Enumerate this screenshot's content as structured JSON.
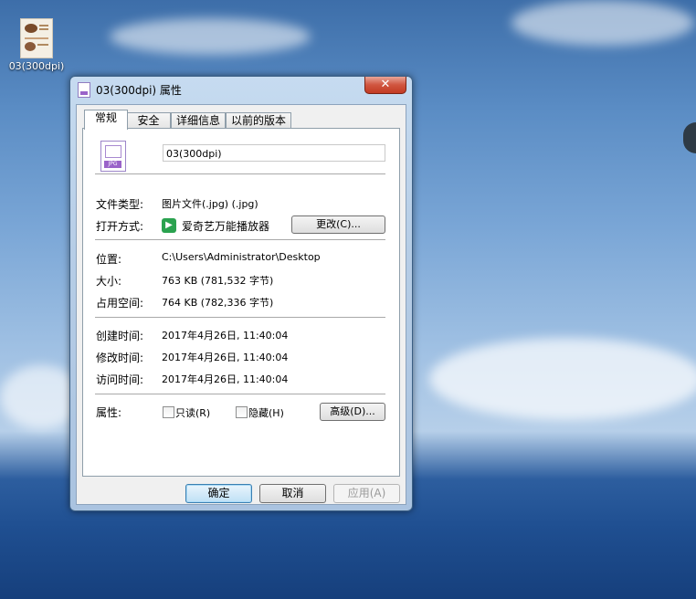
{
  "desktop": {
    "icon_label": "03(300dpi)"
  },
  "window": {
    "title": "03(300dpi) 属性",
    "close_glyph": "✕",
    "tabs": [
      {
        "label": "常规",
        "active": true
      },
      {
        "label": "安全",
        "active": false
      },
      {
        "label": "详细信息",
        "active": false
      },
      {
        "label": "以前的版本",
        "active": false
      }
    ],
    "file_icon_text": "JPG",
    "file_name": "03(300dpi)",
    "file_type": {
      "label": "文件类型:",
      "value": "图片文件(.jpg) (.jpg)"
    },
    "opens_with": {
      "label": "打开方式:",
      "value": "爱奇艺万能播放器",
      "change_button": "更改(C)..."
    },
    "location": {
      "label": "位置:",
      "value": "C:\\Users\\Administrator\\Desktop"
    },
    "size": {
      "label": "大小:",
      "value": "763 KB (781,532 字节)"
    },
    "size_on_disk": {
      "label": "占用空间:",
      "value": "764 KB (782,336 字节)"
    },
    "created": {
      "label": "创建时间:",
      "value": "2017年4月26日, 11:40:04"
    },
    "modified": {
      "label": "修改时间:",
      "value": "2017年4月26日, 11:40:04"
    },
    "accessed": {
      "label": "访问时间:",
      "value": "2017年4月26日, 11:40:04"
    },
    "attributes": {
      "label": "属性:",
      "readonly": "只读(R)",
      "hidden": "隐藏(H)",
      "advanced_button": "高级(D)..."
    },
    "buttons": {
      "ok": "确定",
      "cancel": "取消",
      "apply": "应用(A)"
    }
  }
}
